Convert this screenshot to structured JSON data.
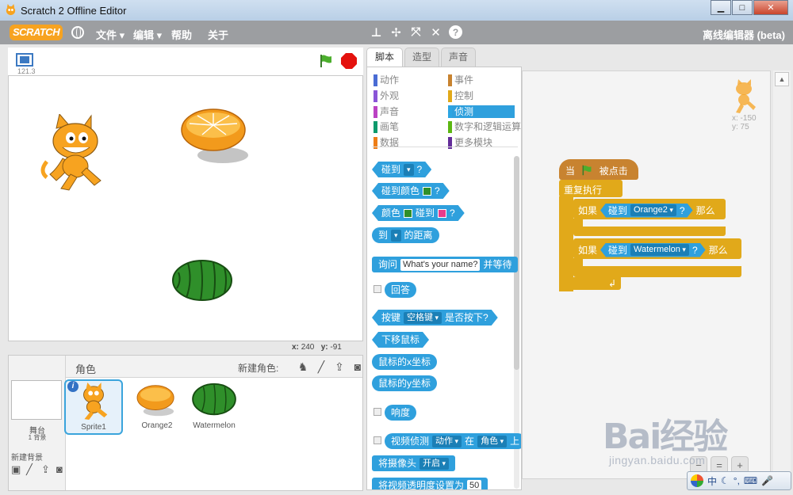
{
  "window": {
    "title": "Scratch 2 Offline Editor",
    "minimize": "▁",
    "maximize": "□",
    "close": "✕"
  },
  "menubar": {
    "logo": "SCRATCH",
    "file": "文件",
    "edit": "编辑",
    "help": "帮助",
    "about": "关于",
    "editor_label": "离线编辑器 (beta)"
  },
  "stage": {
    "version": "121.3",
    "mouse_x_label": "x:",
    "mouse_x": "240",
    "mouse_y_label": "y:",
    "mouse_y": "-91"
  },
  "sprites": {
    "title": "角色",
    "new_sprite_label": "新建角色:",
    "stage_label": "舞台",
    "backdrop_count": "1 背景",
    "new_backdrop_label": "新建背景",
    "items": [
      {
        "name": "Sprite1"
      },
      {
        "name": "Orange2"
      },
      {
        "name": "Watermelon"
      }
    ]
  },
  "tabs": [
    {
      "label": "脚本"
    },
    {
      "label": "造型"
    },
    {
      "label": "声音"
    }
  ],
  "categories": [
    {
      "label": "动作",
      "color": "#4a6cd4"
    },
    {
      "label": "事件",
      "color": "#c88330"
    },
    {
      "label": "外观",
      "color": "#8a55d7"
    },
    {
      "label": "控制",
      "color": "#e1a91a"
    },
    {
      "label": "声音",
      "color": "#bb42c3"
    },
    {
      "label": "侦测",
      "color": "#2ca5e2"
    },
    {
      "label": "画笔",
      "color": "#0e9a6c"
    },
    {
      "label": "数字和逻辑运算",
      "color": "#5cb712"
    },
    {
      "label": "数据",
      "color": "#ee7d16"
    },
    {
      "label": "更多模块",
      "color": "#632d99"
    }
  ],
  "palette": {
    "touching": "碰到",
    "touching_color": "碰到颜色",
    "color_word": "颜色",
    "touching_word": "碰到",
    "q": "?",
    "to": "到",
    "distance": "的距离",
    "ask": "询问",
    "ask_default": "What's your name?",
    "and_wait": "并等待",
    "answer": "回答",
    "key": "按键",
    "space_key": "空格键",
    "pressed": "是否按下?",
    "mouse_down": "下移鼠标",
    "mouse_x": "鼠标的x坐标",
    "mouse_y": "鼠标的y坐标",
    "loudness": "响度",
    "video_on": "视频侦测",
    "motion": "动作",
    "on": "在",
    "sprite": "角色",
    "above": "上",
    "turn_video": "将摄像头",
    "video_state": "开启",
    "transparency": "将视频透明度设置为",
    "transparency_value": "50"
  },
  "script": {
    "sprite_x": "x: -150",
    "sprite_y": "y: 75",
    "when": "当",
    "clicked": "被点击",
    "forever": "重复执行",
    "if1": "如果",
    "touching1": "碰到",
    "target1": "Orange2",
    "q1": "?",
    "then1": "那么",
    "if2": "如果",
    "touching2": "碰到",
    "target2": "Watermelon",
    "q2": "?",
    "then2": "那么",
    "loop_arrow": "↲"
  },
  "ime": {
    "lang": "中"
  },
  "watermark": {
    "main": "Bai经验",
    "sub": "jingyan.baidu.com"
  }
}
